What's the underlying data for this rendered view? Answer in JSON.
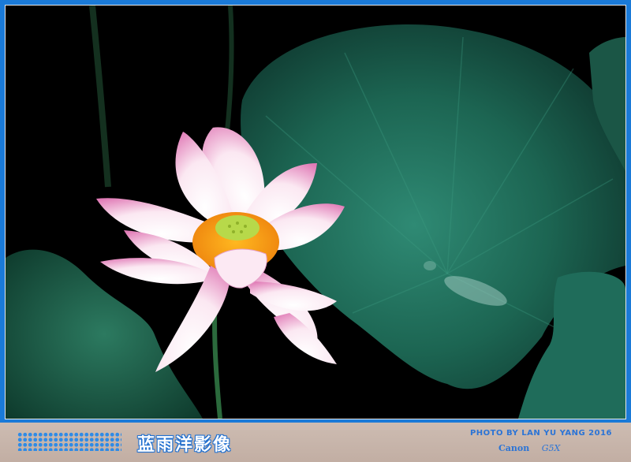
{
  "footer": {
    "chinese_title": "蓝雨洋影像",
    "credit": "PHOTO BY LAN YU YANG  2016",
    "camera_brand": "Canon",
    "camera_model": "G5X"
  },
  "colors": {
    "frame": "#1a7ad8",
    "footer_bg": "#c9b7ad",
    "text_accent": "#2b74d6",
    "petal_pink": "#e88ac0",
    "leaf_green": "#1f6a55"
  }
}
